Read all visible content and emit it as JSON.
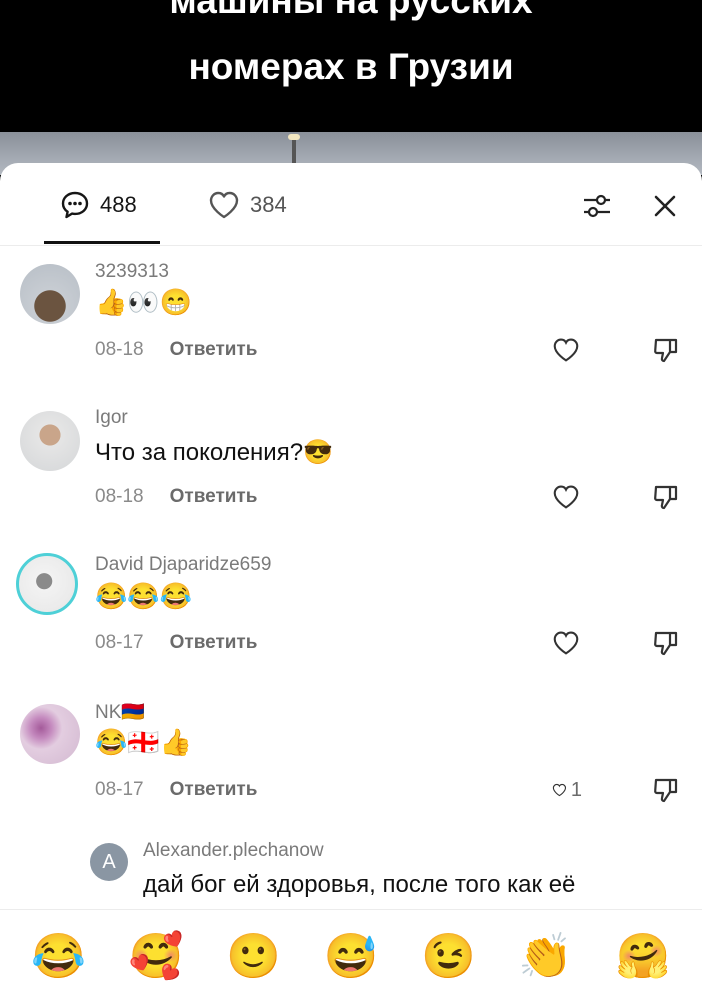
{
  "video": {
    "caption_line1": "машины на русских",
    "caption_line2": "номерах в Грузии"
  },
  "tabs": {
    "comments_count": "488",
    "likes_count": "384"
  },
  "icons": {
    "comments": "comment-bubble-icon",
    "likes": "heart-icon",
    "filter": "sliders-icon",
    "close": "close-icon",
    "like": "heart-outline-icon",
    "dislike": "thumbs-down-icon"
  },
  "comments": [
    {
      "username": "3239313",
      "text": "👍👀😁",
      "date": "08-18",
      "reply_label": "Ответить",
      "likes": ""
    },
    {
      "username": "Igor",
      "text": "Что за поколения?😎",
      "date": "08-18",
      "reply_label": "Ответить",
      "likes": ""
    },
    {
      "username": "David Djaparidze659",
      "text": "😂😂😂",
      "date": "08-17",
      "reply_label": "Ответить",
      "likes": ""
    },
    {
      "username": "NK🇦🇲",
      "text": "😂🇬🇪👍",
      "date": "08-17",
      "reply_label": "Ответить",
      "likes": "1"
    }
  ],
  "reply": {
    "avatar_letter": "A",
    "username": "Alexander.plechanow",
    "text": "дай бог ей здоровья, после того как её"
  },
  "emoji_bar": [
    "😂",
    "🥰",
    "🙂",
    "😅",
    "😉",
    "👏",
    "🤗"
  ]
}
